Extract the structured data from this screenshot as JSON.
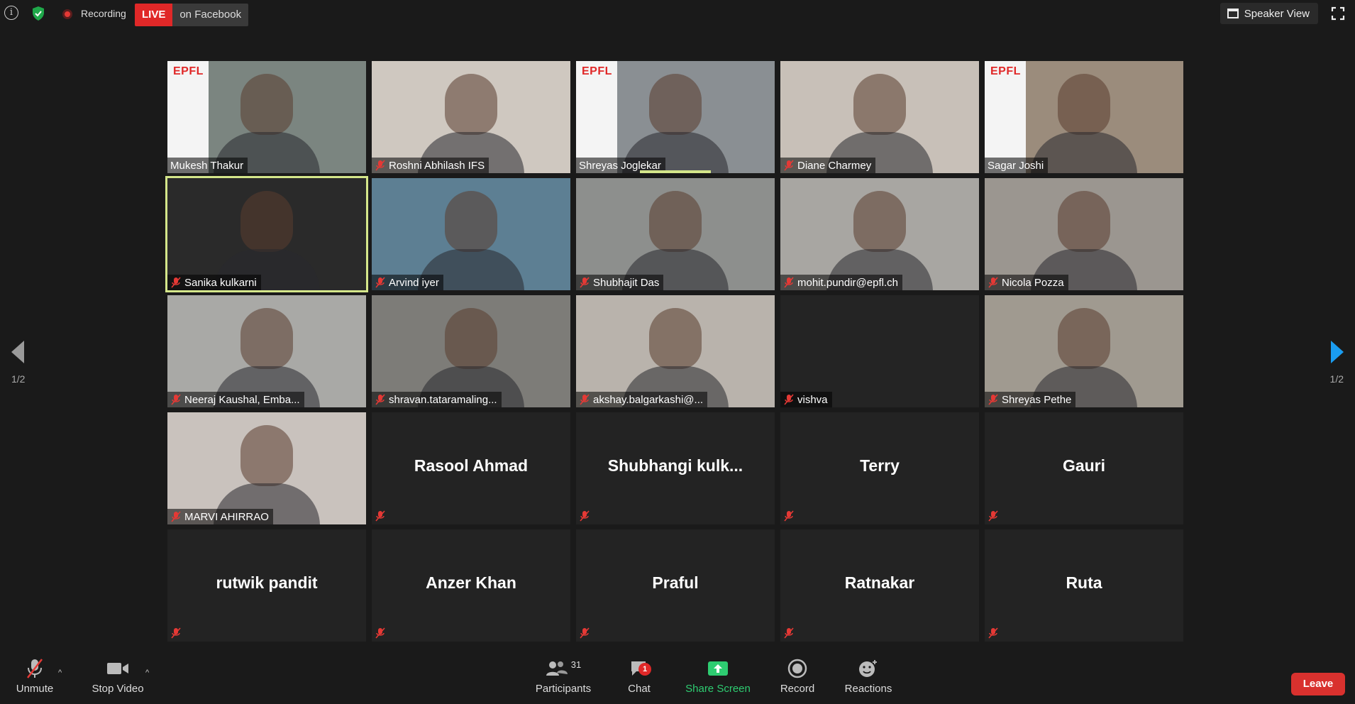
{
  "topbar": {
    "recording_label": "Recording",
    "live_label": "LIVE",
    "live_destination": "on Facebook",
    "speaker_view_label": "Speaker View"
  },
  "tiles": [
    {
      "name": "Mukesh Thakur",
      "video": true,
      "muted": false,
      "epfl": true,
      "bg": "#7b8580"
    },
    {
      "name": "Roshni Abhilash IFS",
      "video": true,
      "muted": true,
      "epfl": false,
      "bg": "#cfc8c0"
    },
    {
      "name": "Shreyas Joglekar",
      "video": true,
      "muted": false,
      "epfl": true,
      "bg": "#8a8f93"
    },
    {
      "name": "Diane Charmey",
      "video": true,
      "muted": true,
      "epfl": false,
      "bg": "#c8c0b8"
    },
    {
      "name": "Sagar Joshi",
      "video": true,
      "muted": false,
      "epfl": true,
      "bg": "#9b8c7c"
    },
    {
      "name": "Sanika kulkarni",
      "video": true,
      "muted": true,
      "epfl": false,
      "bg": "#2a2a2a",
      "active": true
    },
    {
      "name": "Arvind iyer",
      "video": true,
      "muted": true,
      "epfl": false,
      "bg": "#5d7f93"
    },
    {
      "name": "Shubhajit Das",
      "video": true,
      "muted": true,
      "epfl": false,
      "bg": "#8d8f8d"
    },
    {
      "name": "mohit.pundir@epfl.ch",
      "video": true,
      "muted": true,
      "epfl": false,
      "bg": "#a8a6a2"
    },
    {
      "name": "Nicola Pozza",
      "video": true,
      "muted": true,
      "epfl": false,
      "bg": "#9b9690"
    },
    {
      "name": "Neeraj Kaushal, Emba...",
      "video": true,
      "muted": true,
      "epfl": false,
      "bg": "#a9a9a6"
    },
    {
      "name": "shravan.tataramaling...",
      "video": true,
      "muted": true,
      "epfl": false,
      "bg": "#7d7c78"
    },
    {
      "name": "akshay.balgarkashi@...",
      "video": true,
      "muted": true,
      "epfl": false,
      "bg": "#b9b3ac"
    },
    {
      "name": "vishva",
      "video": true,
      "muted": true,
      "epfl": false,
      "bg": "#242424"
    },
    {
      "name": "Shreyas Pethe",
      "video": true,
      "muted": true,
      "epfl": false,
      "bg": "#a09a90"
    },
    {
      "name": "MARVI AHIRRAO",
      "video": true,
      "muted": true,
      "epfl": false,
      "bg": "#c9c2bd"
    },
    {
      "name": "Rasool Ahmad",
      "video": false,
      "muted": true
    },
    {
      "name": "Shubhangi  kulk...",
      "video": false,
      "muted": true
    },
    {
      "name": "Terry",
      "video": false,
      "muted": true
    },
    {
      "name": "Gauri",
      "video": false,
      "muted": true
    },
    {
      "name": "rutwik pandit",
      "video": false,
      "muted": true
    },
    {
      "name": "Anzer Khan",
      "video": false,
      "muted": true
    },
    {
      "name": "Praful",
      "video": false,
      "muted": true
    },
    {
      "name": "Ratnakar",
      "video": false,
      "muted": true
    },
    {
      "name": "Ruta",
      "video": false,
      "muted": true
    }
  ],
  "pagination": {
    "left": "1/2",
    "right": "1/2"
  },
  "bottombar": {
    "unmute_label": "Unmute",
    "stop_video_label": "Stop Video",
    "participants_label": "Participants",
    "participants_count": "31",
    "chat_label": "Chat",
    "chat_badge": "1",
    "share_screen_label": "Share Screen",
    "record_label": "Record",
    "reactions_label": "Reactions",
    "leave_label": "Leave"
  },
  "colors": {
    "live_red": "#e02828",
    "share_green": "#2ecc71",
    "active_speaker": "#d4e68a",
    "leave_red": "#d9312e",
    "nav_blue": "#1a9cf0"
  }
}
